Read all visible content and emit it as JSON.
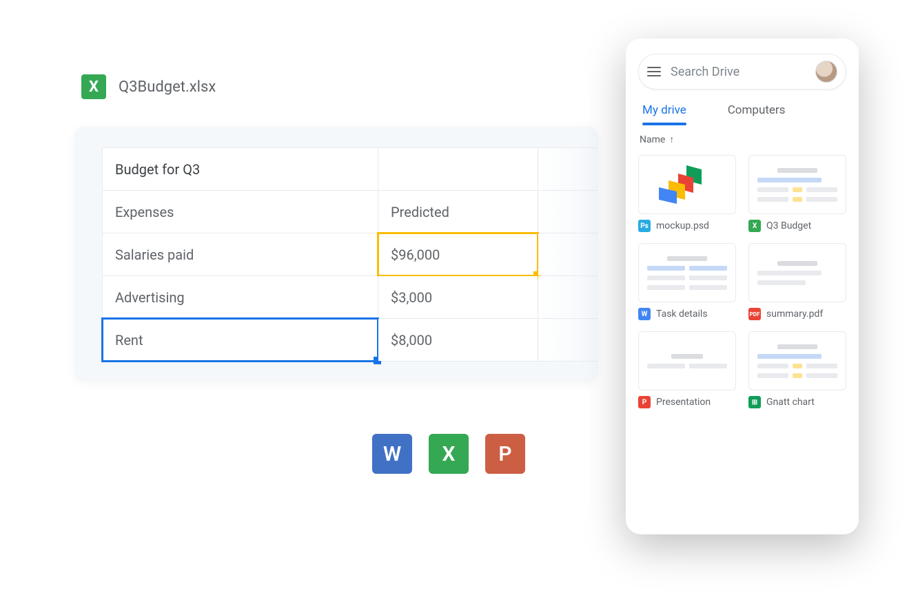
{
  "spreadsheet": {
    "file_name": "Q3Budget.xlsx",
    "rows": [
      {
        "a": "Budget for Q3",
        "b": ""
      },
      {
        "a": "Expenses",
        "b": "Predicted"
      },
      {
        "a": "Salaries paid",
        "b": "$96,000"
      },
      {
        "a": "Advertising",
        "b": "$3,000"
      },
      {
        "a": "Rent",
        "b": "$8,000"
      }
    ]
  },
  "office_icons": {
    "word": "W",
    "excel": "X",
    "powerpoint": "P"
  },
  "drive": {
    "search_placeholder": "Search Drive",
    "tabs": {
      "my_drive": "My drive",
      "computers": "Computers"
    },
    "sort_label": "Name",
    "files": [
      {
        "icon": "Ps",
        "label": "mockup.psd"
      },
      {
        "icon": "X",
        "label": "Q3 Budget"
      },
      {
        "icon": "W",
        "label": "Task details"
      },
      {
        "icon": "PDF",
        "label": "summary.pdf"
      },
      {
        "icon": "P",
        "label": "Presentation"
      },
      {
        "icon": "⊞",
        "label": "Gnatt chart"
      }
    ]
  }
}
